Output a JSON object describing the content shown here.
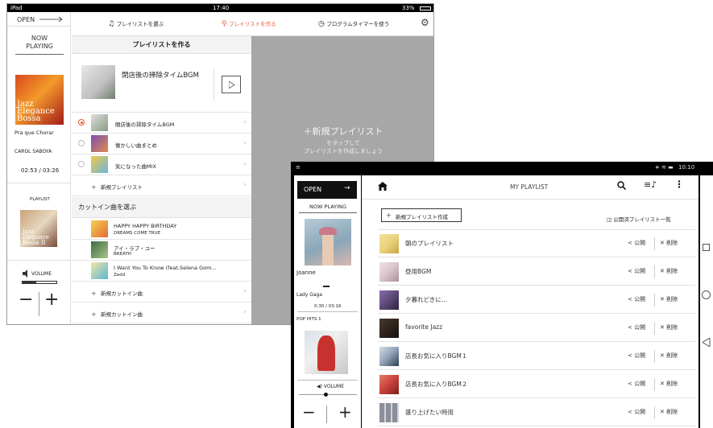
{
  "ipad": {
    "status": {
      "carrier": "iPad",
      "time": "17:40",
      "battery": "33%"
    },
    "sidebar": {
      "open_label": "OPEN",
      "now_playing": "NOW\nPLAYING",
      "album_art_text": "Jazz Elegance Bossa",
      "track_title": "Pra que Chorar",
      "artist": "CAROL SABOYA",
      "time": "02:53 / 03:26",
      "playlist_label": "PLAYLIST",
      "playlist_art_text": "Jazz Elegance Bossa II",
      "volume_label": "VOLUME",
      "minus": "−",
      "plus": "+"
    },
    "topbar": {
      "tabs": [
        {
          "label": "プレイリストを選ぶ",
          "active": false
        },
        {
          "label": "プレイリストを作る",
          "active": true
        },
        {
          "label": "プログラムタイマーを使う",
          "active": false
        }
      ]
    },
    "panel": {
      "title": "プレイリストを作る",
      "featured_title": "閉店後の掃除タイムBGM",
      "playlists": [
        {
          "name": "閉店後の掃除タイムBGM",
          "selected": true
        },
        {
          "name": "懐かしい曲まとめ",
          "selected": false
        },
        {
          "name": "気になった曲MIX",
          "selected": false
        }
      ],
      "new_playlist": "新規プレイリスト",
      "cutin_header": "カットイン曲を選ぶ",
      "cutin_songs": [
        {
          "title": "HAPPY HAPPY BIRTHDAY",
          "artist": "DREAMS COME TRUE"
        },
        {
          "title": "アイ・ラブ・ユー",
          "artist": "BREATH"
        },
        {
          "title": "I Want You To Know (feat.Selena Gom...",
          "artist": "Zedd"
        }
      ],
      "new_cutin_1": "新規カットイン曲",
      "new_cutin_2": "新規カットイン曲"
    },
    "gray_panel": {
      "title": "＋新規プレイリスト",
      "sub1": "をタップして",
      "sub2": "プレイリストを作成しましょう"
    }
  },
  "android": {
    "status": {
      "time": "10:10"
    },
    "sidebar": {
      "open_label": "OPEN",
      "now_playing": "NOW PLAYING",
      "album_title": "Joanne",
      "artist": "Lady Gaga",
      "time": "0:30 / 03:16",
      "playlist_name": "POP HITS 1",
      "volume_label": "VOLUME",
      "minus": "−",
      "plus": "+"
    },
    "header": {
      "title": "MY PLAYLIST"
    },
    "create_button": "新規プレイリスト作成",
    "public_list_link": "公開済プレイリスト一覧",
    "share_label": "公開",
    "delete_label": "削除",
    "playlists": [
      {
        "name": "朝のプレイリスト",
        "color": "#e9d27a"
      },
      {
        "name": "昼用BGM",
        "color": "#d9c3c9"
      },
      {
        "name": "夕暮れどきに…",
        "color": "#5c4a78"
      },
      {
        "name": "favorite Jazz",
        "color": "#2a1f1a"
      },
      {
        "name": "店長お気に入りBGM１",
        "color": "#2f3b4f"
      },
      {
        "name": "店長お気に入りBGM２",
        "color": "#c9403a"
      },
      {
        "name": "盛り上げたい時用",
        "color": "#8b8f99"
      }
    ]
  }
}
